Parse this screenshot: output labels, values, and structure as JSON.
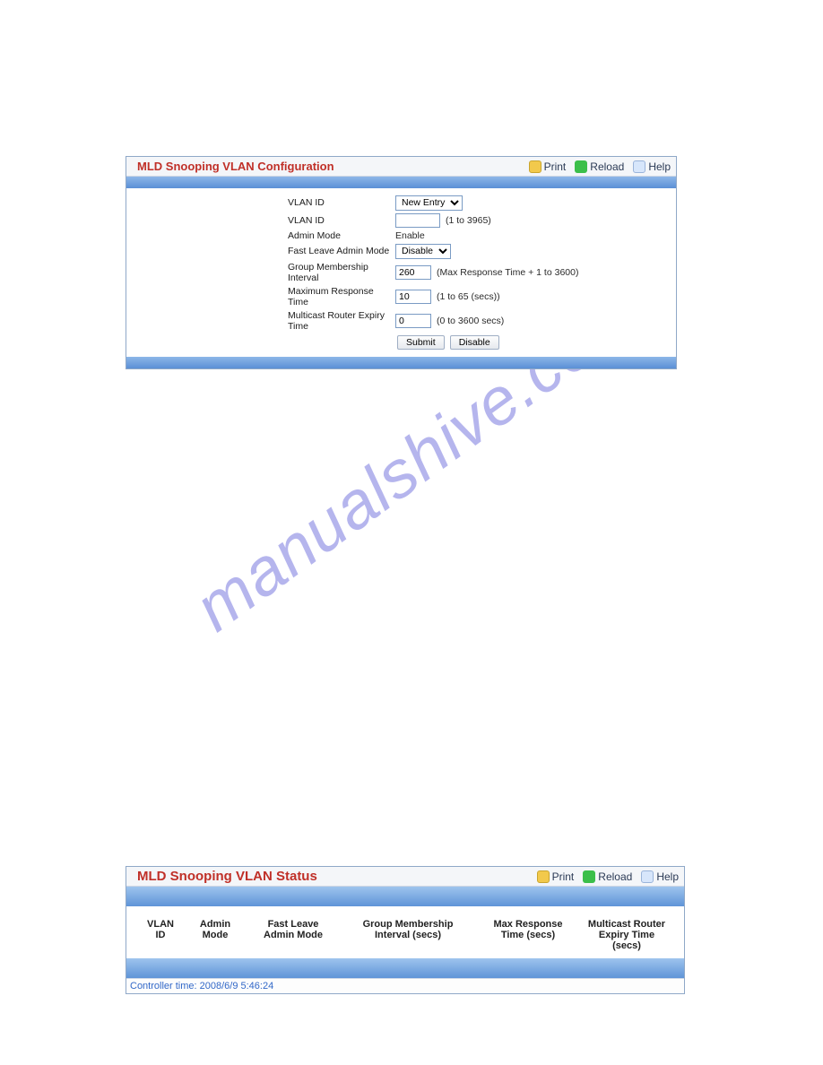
{
  "watermark": "manualshive.com",
  "panel1": {
    "title": "MLD Snooping VLAN Configuration",
    "actions": {
      "print": "Print",
      "reload": "Reload",
      "help": "Help"
    },
    "rows": {
      "vlan_id_sel_label": "VLAN ID",
      "vlan_id_sel_value": "New Entry",
      "vlan_id_txt_label": "VLAN ID",
      "vlan_id_txt_value": "",
      "vlan_id_txt_hint": "(1 to 3965)",
      "admin_mode_label": "Admin Mode",
      "admin_mode_value": "Enable",
      "fast_leave_label": "Fast Leave Admin Mode",
      "fast_leave_value": "Disable",
      "gmi_label": "Group Membership Interval",
      "gmi_value": "260",
      "gmi_hint": "(Max Response Time + 1 to 3600)",
      "mrt_label": "Maximum Response Time",
      "mrt_value": "10",
      "mrt_hint": "(1 to 65 (secs))",
      "mret_label": "Multicast Router Expiry Time",
      "mret_value": "0",
      "mret_hint": "(0 to 3600 secs)"
    },
    "buttons": {
      "submit": "Submit",
      "disable": "Disable"
    }
  },
  "panel2": {
    "title": "MLD Snooping VLAN Status",
    "actions": {
      "print": "Print",
      "reload": "Reload",
      "help": "Help"
    },
    "columns": {
      "c1": "VLAN ID",
      "c2": "Admin Mode",
      "c3": "Fast Leave Admin Mode",
      "c4": "Group Membership Interval (secs)",
      "c5": "Max Response Time (secs)",
      "c6": "Multicast Router Expiry Time (secs)"
    },
    "footer": "Controller time: 2008/6/9 5:46:24"
  }
}
